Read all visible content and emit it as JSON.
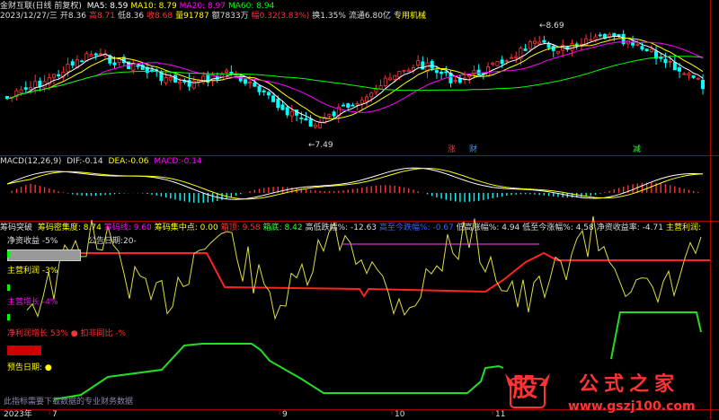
{
  "header": {
    "title": "金财互联(日线 前复权)",
    "ma_values": [
      {
        "label": "MA5:",
        "value": "8.59",
        "color": "#ffffff"
      },
      {
        "label": "MA10:",
        "value": "8.79",
        "color": "#ffff00"
      },
      {
        "label": "MA20:",
        "value": "8.97",
        "color": "#ff00ff"
      },
      {
        "label": "MA60:",
        "value": "8.94",
        "color": "#00ff00"
      }
    ],
    "quote": [
      {
        "label": "2023/12/27/三",
        "value": "",
        "color": "#dddddd"
      },
      {
        "label": "开",
        "value": "8.36",
        "color": "#dddddd"
      },
      {
        "label": "高",
        "value": "8.71",
        "color": "#ff3333"
      },
      {
        "label": "低",
        "value": "8.36",
        "color": "#dddddd"
      },
      {
        "label": "收",
        "value": "8.68",
        "color": "#ff3333"
      },
      {
        "label": "量",
        "value": "91787",
        "color": "#ffff00"
      },
      {
        "label": "额",
        "value": "7833万",
        "color": "#dddddd"
      },
      {
        "label": "幅",
        "value": "0.32(3.83%)",
        "color": "#ff3333"
      },
      {
        "label": "换",
        "value": "1.35%",
        "color": "#dddddd"
      },
      {
        "label": "流通",
        "value": "6.80亿",
        "color": "#dddddd"
      },
      {
        "label": "",
        "value": "专用机械",
        "color": "#ffff00"
      }
    ],
    "price_high_label": "8.69",
    "price_low_label": "7.49",
    "event_tags": [
      {
        "text": "涨",
        "color": "#ff3333"
      },
      {
        "text": "财",
        "color": "#3399ff"
      },
      {
        "text": "减",
        "color": "#33ff33"
      }
    ]
  },
  "macd": {
    "title": "MACD(12,26,9)",
    "dif_label": "DIF:",
    "dif": "-0.14",
    "dea_label": "DEA:",
    "dea": "-0.06",
    "macd_label": "MACD:",
    "macd": "-0.14"
  },
  "chip": {
    "title": "筹码突破",
    "items": [
      {
        "label": "筹码密集度:",
        "value": "8.74",
        "color": "#ffff00"
      },
      {
        "label": "筹码线:",
        "value": "9.60",
        "color": "#ff00ff"
      },
      {
        "label": "筹码集中点:",
        "value": "0.00",
        "color": "#ffff00"
      },
      {
        "label": "箱顶:",
        "value": "9.58",
        "color": "#ff3333"
      },
      {
        "label": "箱底:",
        "value": "8.42",
        "color": "#33ff33"
      },
      {
        "label": "高低跌幅%:",
        "value": "-12.63",
        "color": "#dddddd"
      },
      {
        "label": "高至今跌幅%:",
        "value": "-0.67",
        "color": "#3366ff"
      },
      {
        "label": "低高涨幅%:",
        "value": "4.94",
        "color": "#dddddd"
      },
      {
        "label": "低至今涨幅%:",
        "value": "4.58",
        "color": "#dddddd"
      },
      {
        "label": "净资收益率:",
        "value": "-4.71",
        "color": "#dddddd"
      },
      {
        "label": "主营利润:",
        "value": "",
        "color": "#ffff00"
      }
    ],
    "left_labels": {
      "net_asset_return": "净资收益 -5%",
      "announce_date": "公告日期:20-",
      "main_profit": "主营利润 -3%",
      "main_growth": "主营增长 -4%",
      "net_profit_growth": "净利润增长 53% ● 扣非同比 -%",
      "forecast_date": "预告日期: ●"
    },
    "bottom_note": "此指标需要下载数据的专业财务数据"
  },
  "x_axis": {
    "labels": [
      "2023年",
      "7",
      "9",
      "10",
      "11"
    ]
  },
  "watermark": {
    "main_char": "股",
    "text": "公式之家",
    "url": "www.gszj100.com"
  },
  "colors": {
    "up": "#ff3333",
    "down": "#00ffff",
    "ma5": "#ffffff",
    "ma10": "#ffff00",
    "ma20": "#ff00ff",
    "ma60": "#00ff00",
    "divider": "#aa0000"
  }
}
